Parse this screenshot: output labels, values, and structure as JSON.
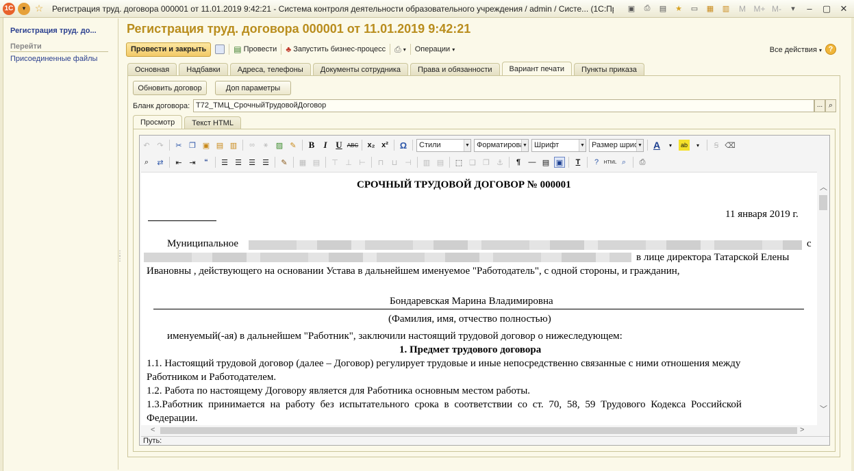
{
  "window": {
    "title": "Регистрация труд. договора 000001 от 11.01.2019 9:42:21 - Система контроля деятельности образовательного учреждения / admin / Систе...   (1С:Предприятие)",
    "app_badge": "1С",
    "m_buttons": [
      "M",
      "M+",
      "M-"
    ]
  },
  "left": {
    "header": "Регистрация труд. до...",
    "goto_label": "Перейти",
    "links": [
      "Присоединенные файлы"
    ]
  },
  "form": {
    "title": "Регистрация труд. договора 000001 от 11.01.2019 9:42:21",
    "toolbar": {
      "post_close": "Провести и закрыть",
      "post": "Провести",
      "start_bp": "Запустить бизнес-процесс",
      "operations": "Операции",
      "all_actions": "Все действия",
      "help": "?"
    },
    "tabs": [
      "Основная",
      "Надбавки",
      "Адреса, телефоны",
      "Документы сотрудника",
      "Права и обязанности",
      "Вариант печати",
      "Пункты приказа"
    ],
    "active_tab": "Вариант печати",
    "refresh_button": "Обновить договор",
    "extra_params_button": "Доп параметры",
    "blank_label": "Бланк договора:",
    "blank_value": "Т72_ТМЦ_СрочныйТрудовойДоговор",
    "blank_more": "...",
    "subtabs": [
      "Просмотр",
      "Текст HTML"
    ],
    "active_subtab": "Просмотр"
  },
  "editor": {
    "style_combo": "Стили",
    "format_combo": "Форматирова",
    "font_combo": "Шрифт",
    "size_combo": "Размер шриф",
    "path_label": "Путь:"
  },
  "document": {
    "heading": "СРОЧНЫЙ ТРУДОВОЙ ДОГОВОР № 000001",
    "date": "11 января 2019 г.",
    "p1_start": "Муниципальное",
    "p1_c": "с",
    "p1_director": "в лице директора Татарской Елены",
    "p1_line3": "Ивановны , действующего на основании Устава в дальнейшем именуемое \"Работодатель\", с одной стороны, и гражданин,",
    "employee": "Бондаревская Марина Владимировна",
    "fio_caption": "(Фамилия, имя, отчество полностью)",
    "named": "именуемый(-ая) в дальнейшем \"Работник\", заключили настоящий трудовой договор о нижеследующем:",
    "section1": "1. Предмет трудового договора",
    "c11a": "1.1. Настоящий трудовой договор (далее – Договор) регулирует трудовые и иные непосредственно связанные с ними отношения между",
    "c11b": "Работником и Работодателем.",
    "c12": "1.2. Работа по настоящему Договору является для Работника основным местом работы.",
    "c13a": "1.3.Работник принимается на работу без испытательного срока в соответствии со ст. 70, 58, 59 Трудового Кодекса Российской",
    "c13b": "Федерации."
  },
  "colors": {
    "title_gold": "#b98d1d",
    "link_blue": "#2a3f8f",
    "panel_bg": "#fbf9e9"
  }
}
